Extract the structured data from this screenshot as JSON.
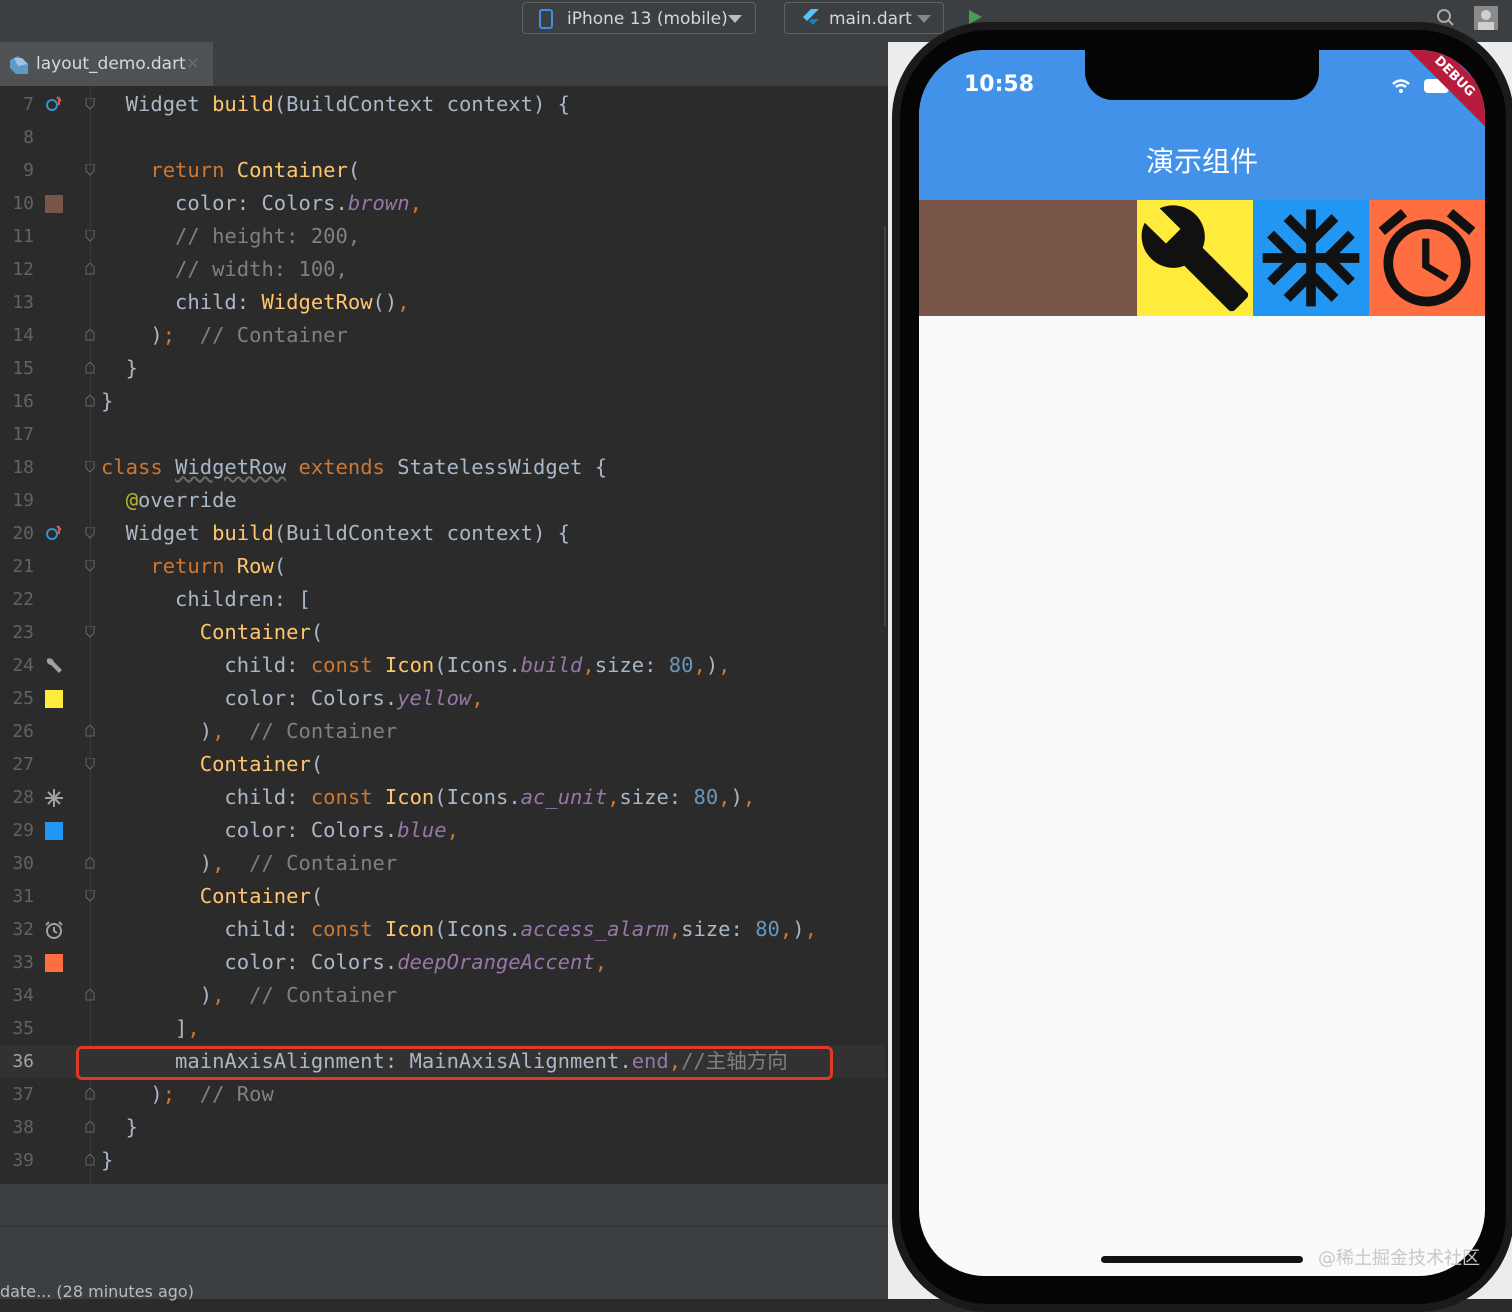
{
  "toolbar": {
    "device_label": "iPhone 13 (mobile)",
    "config_label": "main.dart"
  },
  "tab": {
    "filename": "layout_demo.dart"
  },
  "editor": {
    "highlighted_line": 36,
    "lines": [
      {
        "n": "7"
      },
      {
        "n": "8"
      },
      {
        "n": "9"
      },
      {
        "n": "10"
      },
      {
        "n": "11"
      },
      {
        "n": "12"
      },
      {
        "n": "13"
      },
      {
        "n": "14"
      },
      {
        "n": "15"
      },
      {
        "n": "16"
      },
      {
        "n": "17"
      },
      {
        "n": "18"
      },
      {
        "n": "19"
      },
      {
        "n": "20"
      },
      {
        "n": "21"
      },
      {
        "n": "22"
      },
      {
        "n": "23"
      },
      {
        "n": "24"
      },
      {
        "n": "25"
      },
      {
        "n": "26"
      },
      {
        "n": "27"
      },
      {
        "n": "28"
      },
      {
        "n": "29"
      },
      {
        "n": "30"
      },
      {
        "n": "31"
      },
      {
        "n": "32"
      },
      {
        "n": "33"
      },
      {
        "n": "34"
      },
      {
        "n": "35"
      },
      {
        "n": "36"
      },
      {
        "n": "37"
      },
      {
        "n": "38"
      },
      {
        "n": "39"
      }
    ]
  },
  "status": {
    "text": "date... (28 minutes ago)"
  },
  "phone": {
    "time": "10:58",
    "app_title": "演示组件",
    "debug_banner": "DEBUG",
    "row_colors": {
      "container": "#795548",
      "yellow": "#ffeb3b",
      "blue": "#2196f3",
      "deep_orange_accent": "#ff6e40"
    }
  },
  "watermark": "@稀土掘金技术社区"
}
